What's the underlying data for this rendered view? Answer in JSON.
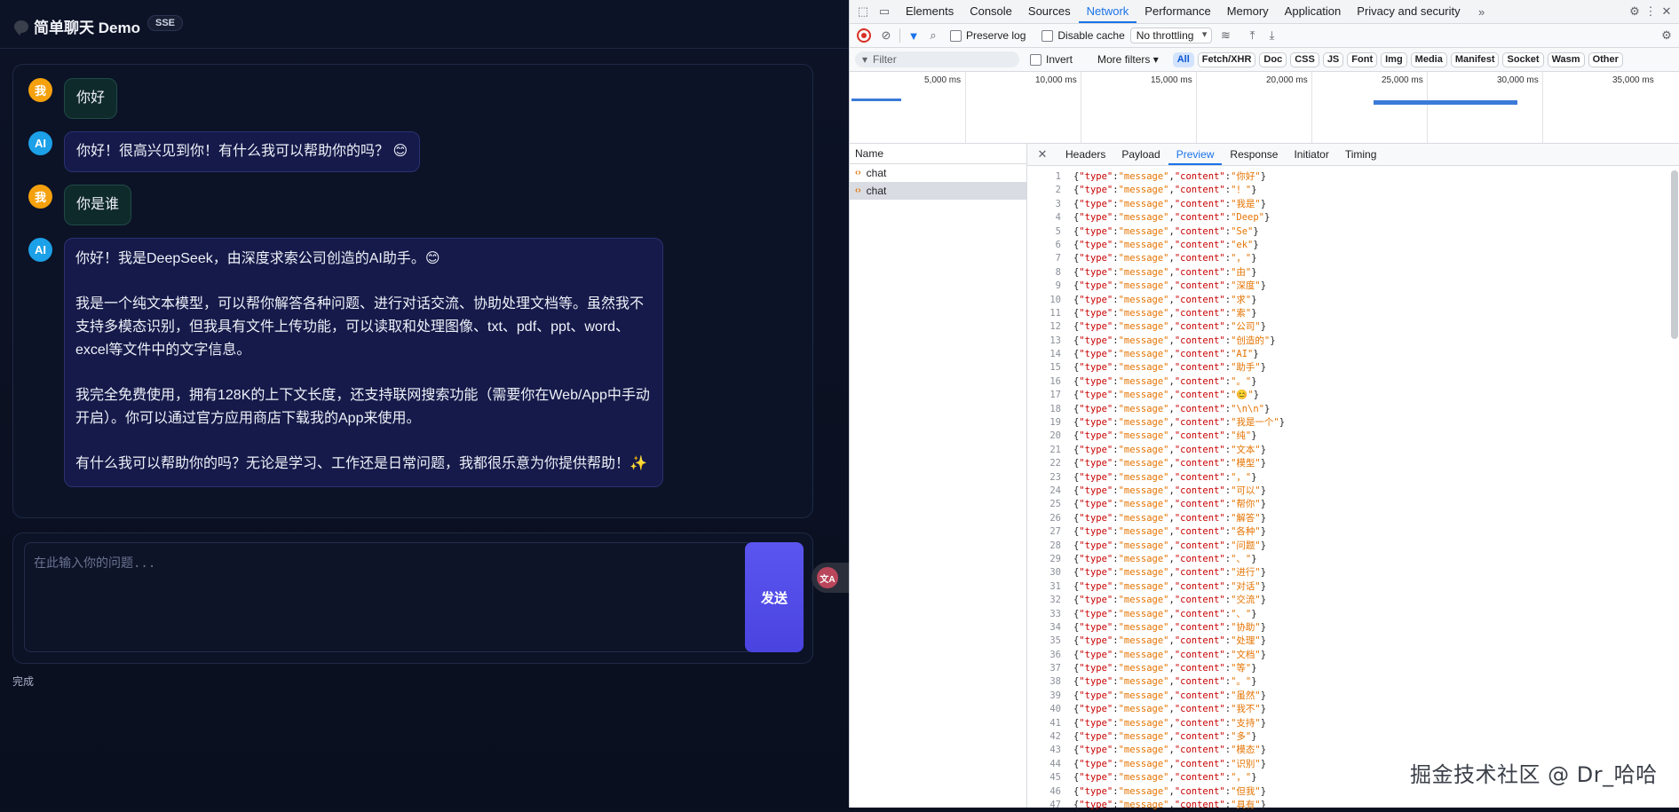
{
  "app": {
    "title": "简单聊天 Demo",
    "badge": "SSE",
    "messages": [
      {
        "role": "user",
        "avatar": "我",
        "paragraphs": [
          "你好"
        ]
      },
      {
        "role": "ai",
        "avatar": "AI",
        "paragraphs": [
          "你好！很高兴见到你！有什么我可以帮助你的吗？ 😊"
        ]
      },
      {
        "role": "user",
        "avatar": "我",
        "paragraphs": [
          "你是谁"
        ]
      },
      {
        "role": "ai",
        "avatar": "AI",
        "paragraphs": [
          "你好！我是DeepSeek，由深度求索公司创造的AI助手。😊",
          "我是一个纯文本模型，可以帮你解答各种问题、进行对话交流、协助处理文档等。虽然我不支持多模态识别，但我具有文件上传功能，可以读取和处理图像、txt、pdf、ppt、word、excel等文件中的文字信息。",
          "我完全免费使用，拥有128K的上下文长度，还支持联网搜索功能（需要你在Web/App中手动开启）。你可以通过官方应用商店下载我的App来使用。",
          "有什么我可以帮助你的吗？无论是学习、工作还是日常问题，我都很乐意为你提供帮助！✨"
        ]
      }
    ],
    "input_placeholder": "在此输入你的问题...",
    "send_label": "发送",
    "status": "完成"
  },
  "devtools": {
    "tabs": [
      "Elements",
      "Console",
      "Sources",
      "Network",
      "Performance",
      "Memory",
      "Application",
      "Privacy and security"
    ],
    "active_tab": "Network",
    "preserve_log": "Preserve log",
    "disable_cache": "Disable cache",
    "throttling": "No throttling",
    "filter_placeholder": "Filter",
    "invert": "Invert",
    "more_filters": "More filters",
    "filter_types": [
      "All",
      "Fetch/XHR",
      "Doc",
      "CSS",
      "JS",
      "Font",
      "Img",
      "Media",
      "Manifest",
      "Socket",
      "Wasm",
      "Other"
    ],
    "timeline_ticks": [
      "5,000 ms",
      "10,000 ms",
      "15,000 ms",
      "20,000 ms",
      "25,000 ms",
      "30,000 ms",
      "35,000 ms"
    ],
    "name_header": "Name",
    "requests": [
      "chat",
      "chat"
    ],
    "detail_tabs": [
      "Headers",
      "Payload",
      "Preview",
      "Response",
      "Initiator",
      "Timing"
    ],
    "active_detail_tab": "Preview",
    "preview_lines": [
      "你好",
      "！",
      "我是",
      "Deep",
      "Se",
      "ek",
      "，",
      "由",
      "深度",
      "求",
      "索",
      "公司",
      "创造的",
      "AI",
      "助手",
      "。",
      "😊",
      "\\n\\n",
      "我是一个",
      "纯",
      "文本",
      "模型",
      "，",
      "可以",
      "帮你",
      "解答",
      "各种",
      "问题",
      "、",
      "进行",
      "对话",
      "交流",
      "、",
      "协助",
      "处理",
      "文档",
      "等",
      "。",
      "虽然",
      "我不",
      "支持",
      "多",
      "模态",
      "识别",
      "，",
      "但我",
      "具有"
    ]
  },
  "watermark": "掘金技术社区 @ Dr_哈哈"
}
